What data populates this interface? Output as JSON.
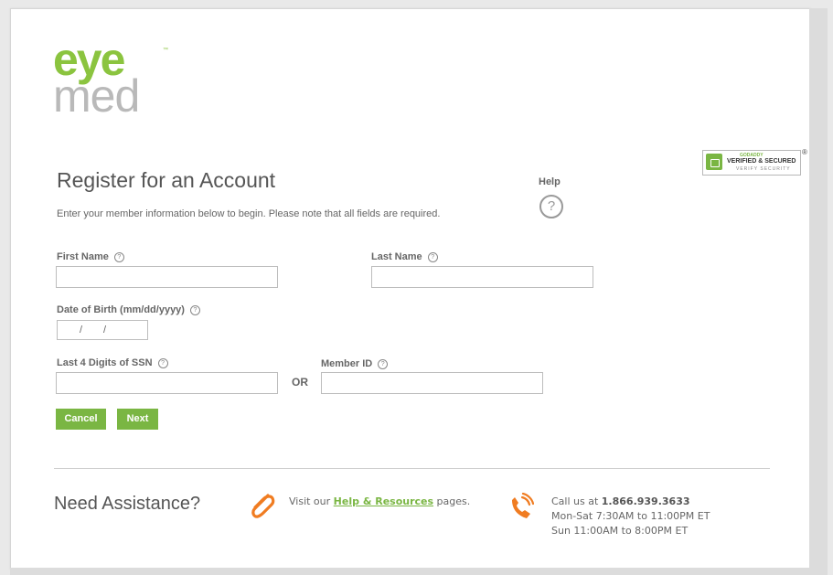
{
  "brand": {
    "logo_top": "eye",
    "logo_bottom": "med",
    "logo_tm": "™"
  },
  "seal": {
    "brand": "GODADDY",
    "line1": "VERIFIED & SECURED",
    "line2": "VERIFY SECURITY",
    "registered_mark": "®"
  },
  "colors": {
    "accent": "#7ab643",
    "logo_green": "#8bc43f",
    "logo_gray": "#b9b9b9",
    "icon_orange": "#f07c21"
  },
  "page": {
    "title": "Register for an Account",
    "intro": "Enter your member information below to begin. Please note that all fields are required."
  },
  "help": {
    "label": "Help",
    "icon": "?"
  },
  "form": {
    "first_name": {
      "label": "First Name",
      "value": ""
    },
    "last_name": {
      "label": "Last Name",
      "value": ""
    },
    "dob": {
      "label": "Date of Birth (mm/dd/yyyy)",
      "separator": "/"
    },
    "ssn": {
      "label": "Last 4 Digits of SSN",
      "value": ""
    },
    "or_text": "OR",
    "member_id": {
      "label": "Member ID",
      "value": ""
    },
    "help_glyph": "?"
  },
  "buttons": {
    "cancel": "Cancel",
    "next": "Next"
  },
  "assistance": {
    "heading": "Need Assistance?",
    "visit_prefix": "Visit our ",
    "visit_link": "Help & Resources",
    "visit_suffix": " pages.",
    "call_prefix": "Call us at ",
    "phone": "1.866.939.3633",
    "hours_weekday": "Mon-Sat 7:30AM to 11:00PM ET",
    "hours_sunday": "Sun 11:00AM to 8:00PM ET"
  },
  "icons": {
    "clip": "paperclip-icon",
    "phone": "phone-icon",
    "lock": "lock-icon",
    "help": "help-circle-icon"
  }
}
